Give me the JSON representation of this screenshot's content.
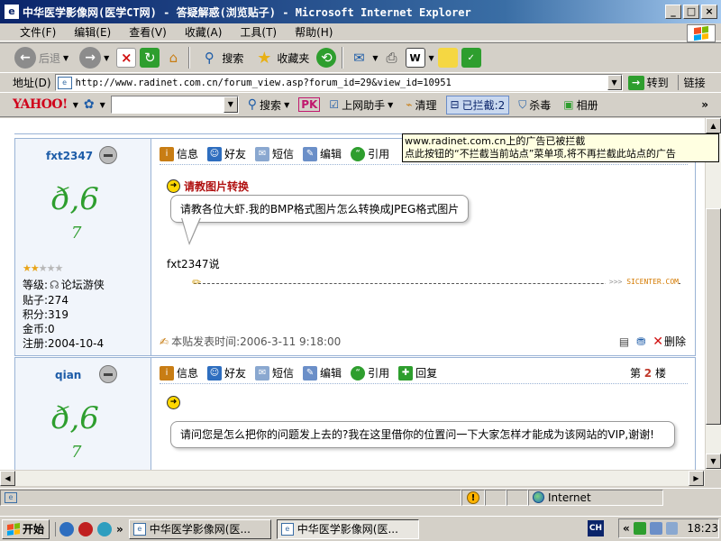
{
  "window": {
    "title": "中华医学影像网(医学CT网) - 答疑解惑(浏览贴子) - Microsoft Internet Explorer",
    "app_icon": "e",
    "controls": [
      "_",
      "□",
      "×"
    ]
  },
  "menu": {
    "items": [
      "文件(F)",
      "编辑(E)",
      "查看(V)",
      "收藏(A)",
      "工具(T)",
      "帮助(H)"
    ]
  },
  "toolbar": {
    "back": "后退",
    "search": "搜索",
    "favorites": "收藏夹"
  },
  "address": {
    "label": "地址(D)",
    "url": "http://www.radinet.com.cn/forum_view.asp?forum_id=29&view_id=10951",
    "go": "转到",
    "links": "链接"
  },
  "yahoo_bar": {
    "logo": "YAHOO!",
    "search": "搜索",
    "pk": "PK",
    "assistant": "上网助手",
    "clean": "清理",
    "blocked": "已拦截:2",
    "antivirus": "杀毒",
    "album": "相册",
    "more": "»"
  },
  "tooltip": {
    "line1": "www.radinet.com.cn上的广告已被拦截",
    "line2": "点此按钮的“不拦截当前站点”菜单项,将不再拦截此站点的广告"
  },
  "actions": {
    "info": "信息",
    "friend": "好友",
    "message": "短信",
    "edit": "编辑",
    "quote": "引用",
    "reply": "回复"
  },
  "post1": {
    "username": "fxt2347",
    "avatar_text": "ð,6",
    "avatar_tail": "7",
    "stars_on": "★★",
    "stars_off": "★★★",
    "level_label": "等级:",
    "level_value": "论坛游侠",
    "posts": "贴子:274",
    "points": "积分:319",
    "gold": "金币:0",
    "registered": "注册:2004-10-4",
    "title": "请教图片转换",
    "body": "请教各位大虾.我的BMP格式图片怎么转换成JPEG格式图片",
    "said": "fxt2347说",
    "sig_mark": "SICENTER.COM",
    "sig_chevrons": ">>>",
    "posted_at": "本贴发表时间:2006-3-11 9:18:00",
    "delete": "删除"
  },
  "post2": {
    "username": "qian",
    "avatar_text": "ð,6",
    "avatar_tail": "7",
    "floor_prefix": "第",
    "floor_number": "2",
    "floor_suffix": "楼",
    "body": "请问您是怎么把你的问题发上去的?我在这里借你的位置问一下大家怎样才能成为该网站的VIP,谢谢!"
  },
  "status": {
    "zone": "Internet"
  },
  "taskbar": {
    "start": "开始",
    "more": "»",
    "task1": "中华医学影像网(医...",
    "task2": "中华医学影像网(医...",
    "lang": "CH",
    "tray_more": "«",
    "time": "18:23"
  }
}
